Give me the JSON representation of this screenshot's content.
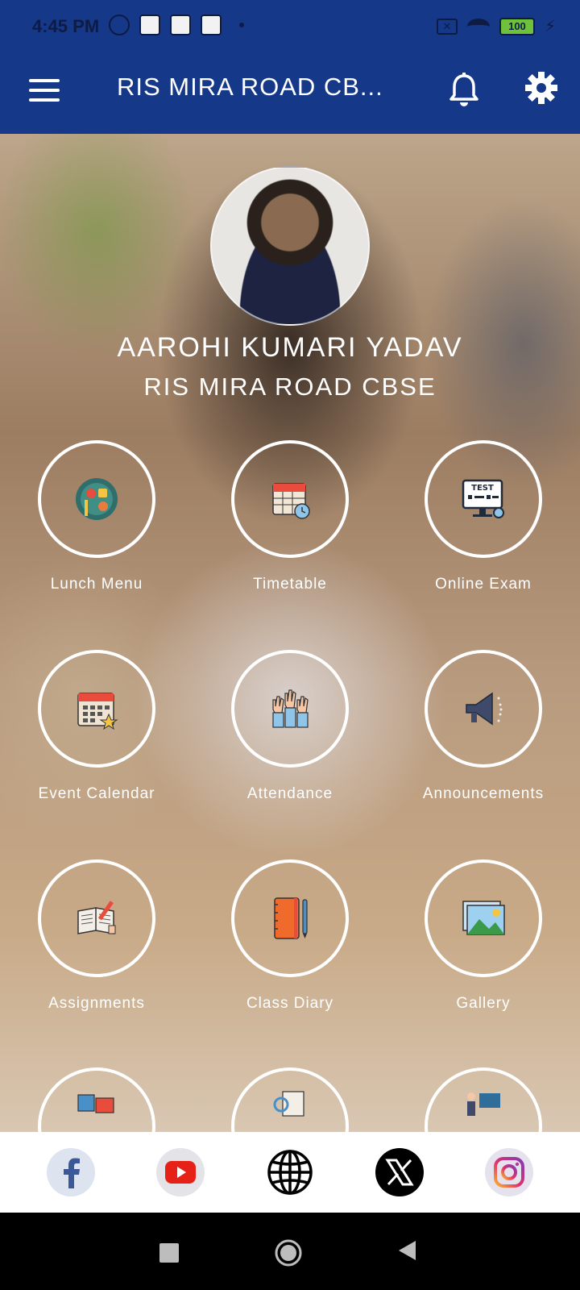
{
  "status": {
    "time": "4:45 PM",
    "battery": "100"
  },
  "header": {
    "title": "RIS MIRA ROAD CB..."
  },
  "profile": {
    "name": "AAROHI KUMARI YADAV",
    "school": "RIS MIRA ROAD CBSE"
  },
  "tiles": [
    {
      "label": "Lunch Menu",
      "icon": "lunch-menu-icon"
    },
    {
      "label": "Timetable",
      "icon": "timetable-icon"
    },
    {
      "label": "Online Exam",
      "icon": "online-exam-icon"
    },
    {
      "label": "Event Calendar",
      "icon": "event-calendar-icon"
    },
    {
      "label": "Attendance",
      "icon": "attendance-icon"
    },
    {
      "label": "Announcements",
      "icon": "megaphone-icon"
    },
    {
      "label": "Assignments",
      "icon": "assignments-icon"
    },
    {
      "label": "Class Diary",
      "icon": "class-diary-icon"
    },
    {
      "label": "Gallery",
      "icon": "gallery-icon"
    }
  ],
  "social": [
    "facebook-icon",
    "youtube-icon",
    "globe-icon",
    "x-icon",
    "instagram-icon"
  ],
  "colors": {
    "primary": "#163888",
    "social_bar_bg": "#ffffff"
  }
}
